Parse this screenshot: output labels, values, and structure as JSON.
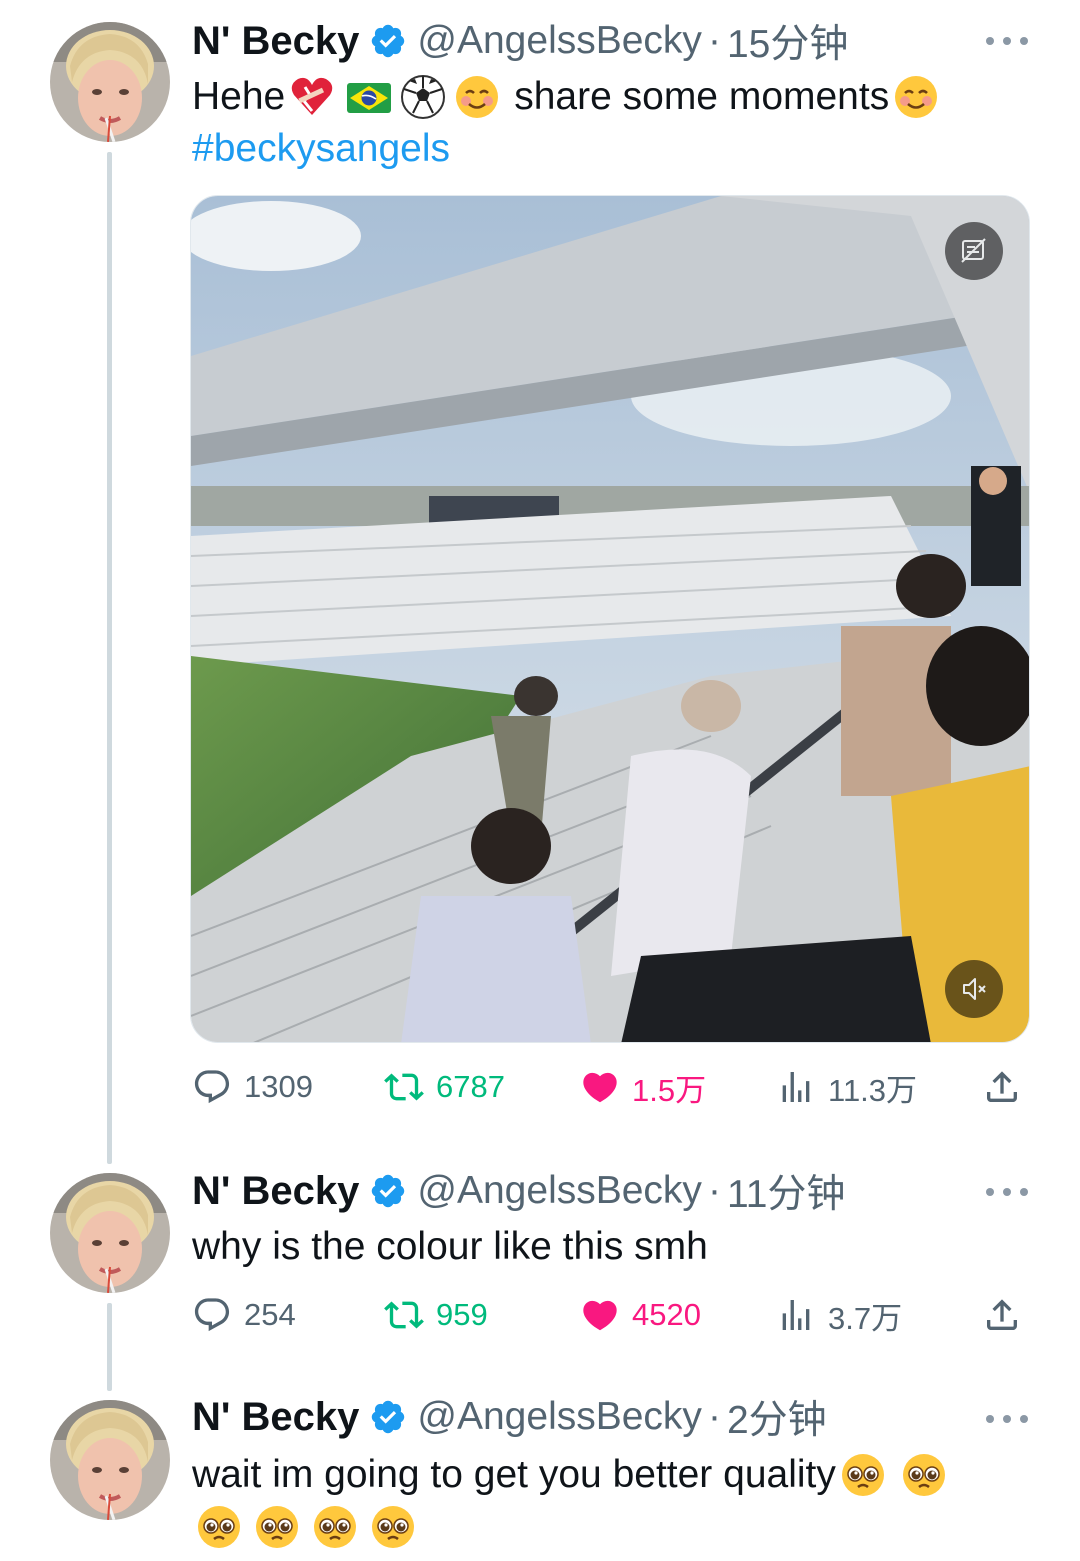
{
  "colors": {
    "verified": "#1d9bf0",
    "hashtag": "#1d9bf0",
    "retweet_active": "#00ba7c",
    "like_active": "#f91880",
    "muted_text": "#536471"
  },
  "tweets": [
    {
      "author": {
        "name": "N' Becky",
        "handle": "@AngelssBecky",
        "verified": true,
        "avatar": "avatar-photo"
      },
      "separator": "·",
      "time": "15分钟",
      "text_line1": {
        "prefix": "Hehe",
        "emojis": [
          "mended-heart-emoji",
          "brazil-flag-emoji",
          "soccer-ball-emoji",
          "smiling-face-emoji"
        ],
        "middle": "share some moments",
        "suffix_emojis": [
          "smiling-face-emoji"
        ]
      },
      "hashtag": "#beckysangels",
      "media": {
        "type": "video",
        "description_icon": "alt-text-icon",
        "sound_icon": "muted-speaker-icon"
      },
      "stats": {
        "replies": "1309",
        "retweets": "6787",
        "likes": "1.5万",
        "views": "11.3万"
      }
    },
    {
      "author": {
        "name": "N' Becky",
        "handle": "@AngelssBecky",
        "verified": true,
        "avatar": "avatar-photo"
      },
      "separator": "·",
      "time": "11分钟",
      "text": "why is the colour like this smh",
      "stats": {
        "replies": "254",
        "retweets": "959",
        "likes": "4520",
        "views": "3.7万"
      }
    },
    {
      "author": {
        "name": "N' Becky",
        "handle": "@AngelssBecky",
        "verified": true,
        "avatar": "avatar-photo"
      },
      "separator": "·",
      "time": "2分钟",
      "text": "wait im going to get you better quality",
      "emojis": [
        "pleading-face-emoji",
        "pleading-face-emoji",
        "pleading-face-emoji",
        "pleading-face-emoji",
        "pleading-face-emoji",
        "pleading-face-emoji"
      ]
    }
  ]
}
